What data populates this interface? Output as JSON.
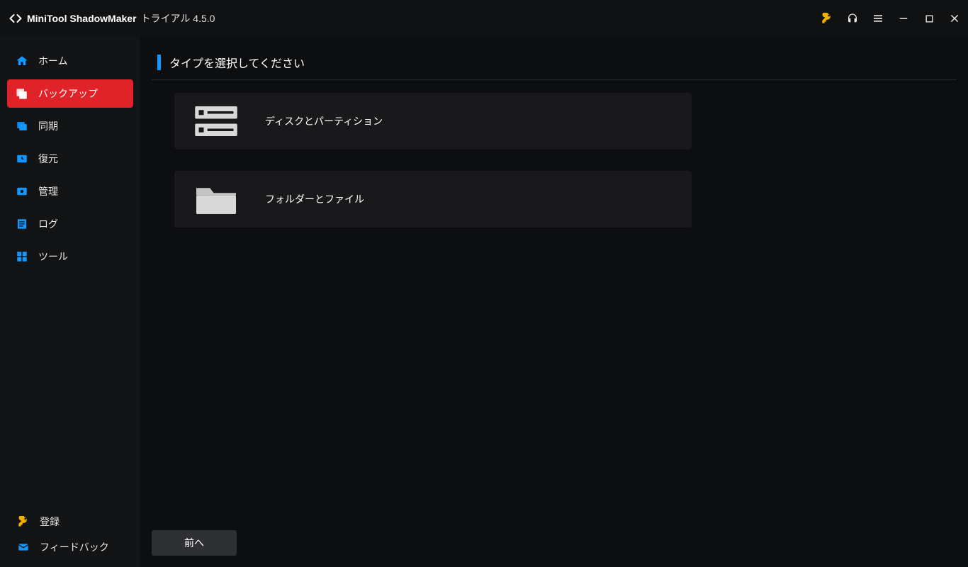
{
  "titlebar": {
    "app_name": "MiniTool ShadowMaker",
    "edition": "トライアル 4.5.0"
  },
  "sidebar": {
    "items": [
      {
        "label": "ホーム",
        "icon": "home"
      },
      {
        "label": "バックアップ",
        "icon": "backup",
        "active": true
      },
      {
        "label": "同期",
        "icon": "sync"
      },
      {
        "label": "復元",
        "icon": "restore"
      },
      {
        "label": "管理",
        "icon": "manage"
      },
      {
        "label": "ログ",
        "icon": "log"
      },
      {
        "label": "ツール",
        "icon": "tools"
      }
    ],
    "bottom": {
      "register": "登録",
      "feedback": "フィードバック"
    }
  },
  "main": {
    "heading": "タイプを選択してください",
    "options": [
      {
        "label": "ディスクとパーティション",
        "icon": "disk"
      },
      {
        "label": "フォルダーとファイル",
        "icon": "folder"
      }
    ],
    "prev_button": "前へ"
  }
}
